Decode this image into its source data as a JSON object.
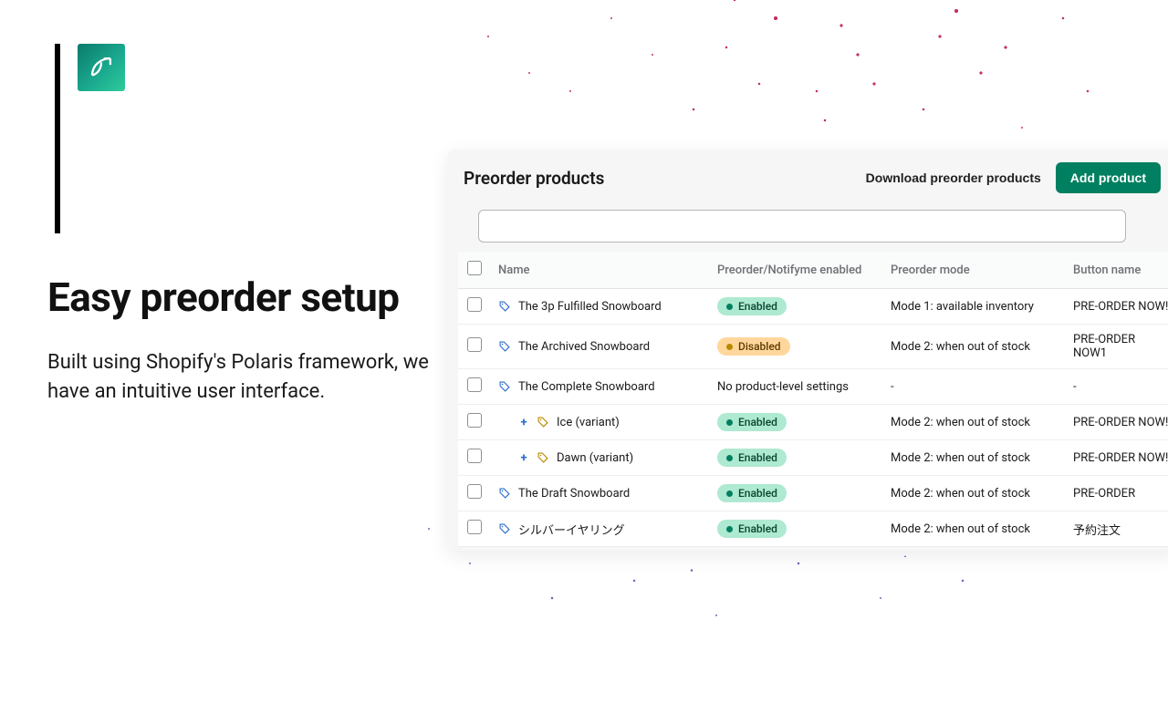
{
  "marketing": {
    "headline": "Easy preorder setup",
    "subhead": "Built using Shopify's Polaris framework, we have an intuitive user interface."
  },
  "panel": {
    "title": "Preorder products",
    "download_label": "Download preorder products",
    "add_label": "Add product",
    "search_placeholder": ""
  },
  "table": {
    "headers": {
      "name": "Name",
      "status": "Preorder/Notifyme enabled",
      "mode": "Preorder mode",
      "button": "Button name"
    },
    "rows": [
      {
        "name": "The 3p Fulfilled Snowboard",
        "icon": "tag",
        "variant": false,
        "status": "Enabled",
        "status_kind": "enabled",
        "mode": "Mode 1: available inventory",
        "button": "PRE-ORDER NOW!"
      },
      {
        "name": "The Archived Snowboard",
        "icon": "tag",
        "variant": false,
        "status": "Disabled",
        "status_kind": "disabled",
        "mode": "Mode 2: when out of stock",
        "button": "PRE-ORDER NOW1"
      },
      {
        "name": "The Complete Snowboard",
        "icon": "tag",
        "variant": false,
        "status": "No product-level settings",
        "status_kind": "plain",
        "mode": "-",
        "button": "-"
      },
      {
        "name": "Ice (variant)",
        "icon": "tag",
        "variant": true,
        "status": "Enabled",
        "status_kind": "enabled",
        "mode": "Mode 2: when out of stock",
        "button": "PRE-ORDER NOW!"
      },
      {
        "name": "Dawn (variant)",
        "icon": "tag",
        "variant": true,
        "status": "Enabled",
        "status_kind": "enabled",
        "mode": "Mode 2: when out of stock",
        "button": "PRE-ORDER NOW!"
      },
      {
        "name": "The Draft Snowboard",
        "icon": "tag",
        "variant": false,
        "status": "Enabled",
        "status_kind": "enabled",
        "mode": "Mode 2: when out of stock",
        "button": "PRE-ORDER"
      },
      {
        "name": "シルバーイヤリング",
        "icon": "tag",
        "variant": false,
        "status": "Enabled",
        "status_kind": "enabled",
        "mode": "Mode 2: when out of stock",
        "button": "予約注文"
      }
    ]
  },
  "colors": {
    "primary": "#008060",
    "enabled_bg": "#aee9d1",
    "disabled_bg": "#ffd79d"
  }
}
